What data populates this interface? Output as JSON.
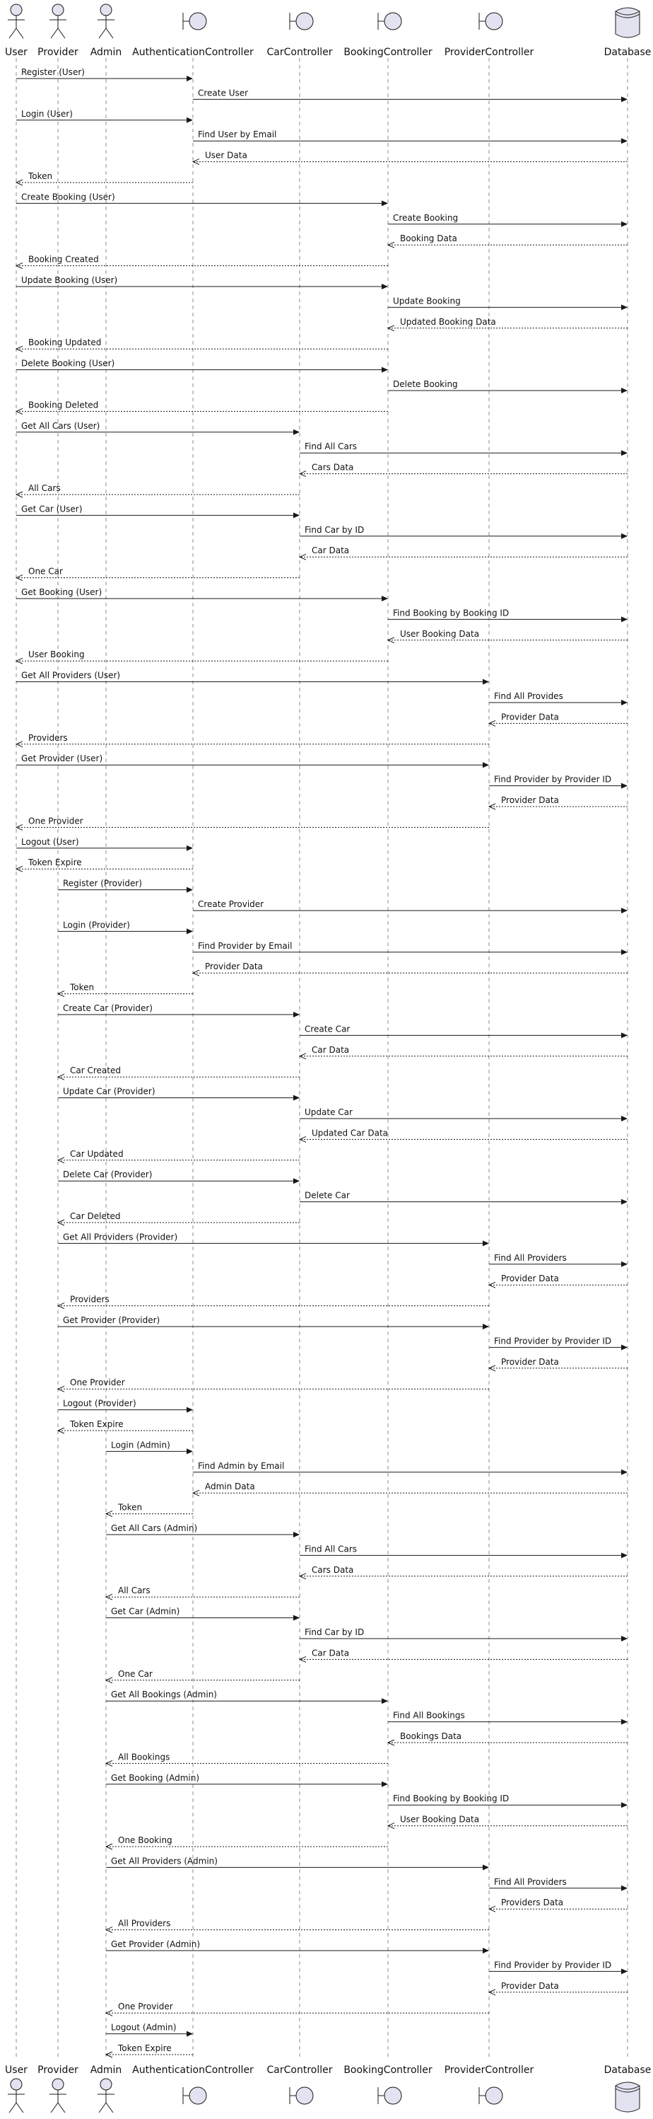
{
  "colors": {
    "shape_fill": "#e2e2f0",
    "line": "#181818",
    "lifeline": "#8a8a8a"
  },
  "participants": [
    {
      "id": "user",
      "name": "User",
      "shape": "actor"
    },
    {
      "id": "provider",
      "name": "Provider",
      "shape": "actor"
    },
    {
      "id": "admin",
      "name": "Admin",
      "shape": "actor"
    },
    {
      "id": "auth",
      "name": "AuthenticationController",
      "shape": "boundary"
    },
    {
      "id": "car",
      "name": "CarController",
      "shape": "boundary"
    },
    {
      "id": "booking",
      "name": "BookingController",
      "shape": "boundary"
    },
    {
      "id": "provctrl",
      "name": "ProviderController",
      "shape": "boundary"
    },
    {
      "id": "db",
      "name": "Database",
      "shape": "database"
    }
  ],
  "messages": [
    {
      "from": "user",
      "to": "auth",
      "label": "Register (User)",
      "style": "solid"
    },
    {
      "from": "auth",
      "to": "db",
      "label": "Create User",
      "style": "solid"
    },
    {
      "from": "user",
      "to": "auth",
      "label": "Login (User)",
      "style": "solid"
    },
    {
      "from": "auth",
      "to": "db",
      "label": "Find User by Email",
      "style": "solid"
    },
    {
      "from": "db",
      "to": "auth",
      "label": "User Data",
      "style": "dashed"
    },
    {
      "from": "auth",
      "to": "user",
      "label": "Token",
      "style": "dashed"
    },
    {
      "from": "user",
      "to": "booking",
      "label": "Create Booking (User)",
      "style": "solid"
    },
    {
      "from": "booking",
      "to": "db",
      "label": "Create Booking",
      "style": "solid"
    },
    {
      "from": "db",
      "to": "booking",
      "label": "Booking Data",
      "style": "dashed"
    },
    {
      "from": "booking",
      "to": "user",
      "label": "Booking Created",
      "style": "dashed"
    },
    {
      "from": "user",
      "to": "booking",
      "label": "Update Booking (User)",
      "style": "solid"
    },
    {
      "from": "booking",
      "to": "db",
      "label": "Update Booking",
      "style": "solid"
    },
    {
      "from": "db",
      "to": "booking",
      "label": "Updated Booking Data",
      "style": "dashed"
    },
    {
      "from": "booking",
      "to": "user",
      "label": "Booking Updated",
      "style": "dashed"
    },
    {
      "from": "user",
      "to": "booking",
      "label": "Delete Booking (User)",
      "style": "solid"
    },
    {
      "from": "booking",
      "to": "db",
      "label": "Delete Booking",
      "style": "solid"
    },
    {
      "from": "booking",
      "to": "user",
      "label": "Booking Deleted",
      "style": "dashed"
    },
    {
      "from": "user",
      "to": "car",
      "label": "Get All Cars (User)",
      "style": "solid"
    },
    {
      "from": "car",
      "to": "db",
      "label": "Find All Cars",
      "style": "solid"
    },
    {
      "from": "db",
      "to": "car",
      "label": "Cars Data",
      "style": "dashed"
    },
    {
      "from": "car",
      "to": "user",
      "label": "All Cars",
      "style": "dashed"
    },
    {
      "from": "user",
      "to": "car",
      "label": "Get Car (User)",
      "style": "solid"
    },
    {
      "from": "car",
      "to": "db",
      "label": "Find Car by ID",
      "style": "solid"
    },
    {
      "from": "db",
      "to": "car",
      "label": "Car Data",
      "style": "dashed"
    },
    {
      "from": "car",
      "to": "user",
      "label": "One Car",
      "style": "dashed"
    },
    {
      "from": "user",
      "to": "booking",
      "label": "Get Booking (User)",
      "style": "solid"
    },
    {
      "from": "booking",
      "to": "db",
      "label": "Find Booking by Booking ID",
      "style": "solid"
    },
    {
      "from": "db",
      "to": "booking",
      "label": "User Booking Data",
      "style": "dashed"
    },
    {
      "from": "booking",
      "to": "user",
      "label": "User Booking",
      "style": "dashed"
    },
    {
      "from": "user",
      "to": "provctrl",
      "label": "Get All Providers (User)",
      "style": "solid"
    },
    {
      "from": "provctrl",
      "to": "db",
      "label": "Find All Provides",
      "style": "solid"
    },
    {
      "from": "db",
      "to": "provctrl",
      "label": "Provider Data",
      "style": "dashed"
    },
    {
      "from": "provctrl",
      "to": "user",
      "label": "Providers",
      "style": "dashed"
    },
    {
      "from": "user",
      "to": "provctrl",
      "label": "Get Provider (User)",
      "style": "solid"
    },
    {
      "from": "provctrl",
      "to": "db",
      "label": "Find Provider by Provider ID",
      "style": "solid"
    },
    {
      "from": "db",
      "to": "provctrl",
      "label": "Provider Data",
      "style": "dashed"
    },
    {
      "from": "provctrl",
      "to": "user",
      "label": "One Provider",
      "style": "dashed"
    },
    {
      "from": "user",
      "to": "auth",
      "label": "Logout (User)",
      "style": "solid"
    },
    {
      "from": "auth",
      "to": "user",
      "label": "Token Expire",
      "style": "dashed"
    },
    {
      "from": "provider",
      "to": "auth",
      "label": "Register (Provider)",
      "style": "solid"
    },
    {
      "from": "auth",
      "to": "db",
      "label": "Create Provider",
      "style": "solid"
    },
    {
      "from": "provider",
      "to": "auth",
      "label": "Login (Provider)",
      "style": "solid"
    },
    {
      "from": "auth",
      "to": "db",
      "label": "Find Provider by Email",
      "style": "solid"
    },
    {
      "from": "db",
      "to": "auth",
      "label": "Provider Data",
      "style": "dashed"
    },
    {
      "from": "auth",
      "to": "provider",
      "label": "Token",
      "style": "dashed"
    },
    {
      "from": "provider",
      "to": "car",
      "label": "Create Car (Provider)",
      "style": "solid"
    },
    {
      "from": "car",
      "to": "db",
      "label": "Create Car",
      "style": "solid"
    },
    {
      "from": "db",
      "to": "car",
      "label": "Car Data",
      "style": "dashed"
    },
    {
      "from": "car",
      "to": "provider",
      "label": "Car Created",
      "style": "dashed"
    },
    {
      "from": "provider",
      "to": "car",
      "label": "Update Car (Provider)",
      "style": "solid"
    },
    {
      "from": "car",
      "to": "db",
      "label": "Update Car",
      "style": "solid"
    },
    {
      "from": "db",
      "to": "car",
      "label": "Updated Car Data",
      "style": "dashed"
    },
    {
      "from": "car",
      "to": "provider",
      "label": "Car Updated",
      "style": "dashed"
    },
    {
      "from": "provider",
      "to": "car",
      "label": "Delete Car (Provider)",
      "style": "solid"
    },
    {
      "from": "car",
      "to": "db",
      "label": "Delete Car",
      "style": "solid"
    },
    {
      "from": "car",
      "to": "provider",
      "label": "Car Deleted",
      "style": "dashed"
    },
    {
      "from": "provider",
      "to": "provctrl",
      "label": "Get All Providers (Provider)",
      "style": "solid"
    },
    {
      "from": "provctrl",
      "to": "db",
      "label": "Find All Providers",
      "style": "solid"
    },
    {
      "from": "db",
      "to": "provctrl",
      "label": "Provider Data",
      "style": "dashed"
    },
    {
      "from": "provctrl",
      "to": "provider",
      "label": "Providers",
      "style": "dashed"
    },
    {
      "from": "provider",
      "to": "provctrl",
      "label": "Get Provider (Provider)",
      "style": "solid"
    },
    {
      "from": "provctrl",
      "to": "db",
      "label": "Find Provider by Provider ID",
      "style": "solid"
    },
    {
      "from": "db",
      "to": "provctrl",
      "label": "Provider Data",
      "style": "dashed"
    },
    {
      "from": "provctrl",
      "to": "provider",
      "label": "One Provider",
      "style": "dashed"
    },
    {
      "from": "provider",
      "to": "auth",
      "label": "Logout (Provider)",
      "style": "solid"
    },
    {
      "from": "auth",
      "to": "provider",
      "label": "Token Expire",
      "style": "dashed"
    },
    {
      "from": "admin",
      "to": "auth",
      "label": "Login (Admin)",
      "style": "solid"
    },
    {
      "from": "auth",
      "to": "db",
      "label": "Find Admin by Email",
      "style": "solid"
    },
    {
      "from": "db",
      "to": "auth",
      "label": "Admin Data",
      "style": "dashed"
    },
    {
      "from": "auth",
      "to": "admin",
      "label": "Token",
      "style": "dashed"
    },
    {
      "from": "admin",
      "to": "car",
      "label": "Get All Cars (Admin)",
      "style": "solid"
    },
    {
      "from": "car",
      "to": "db",
      "label": "Find All Cars",
      "style": "solid"
    },
    {
      "from": "db",
      "to": "car",
      "label": "Cars Data",
      "style": "dashed"
    },
    {
      "from": "car",
      "to": "admin",
      "label": "All Cars",
      "style": "dashed"
    },
    {
      "from": "admin",
      "to": "car",
      "label": "Get Car (Admin)",
      "style": "solid"
    },
    {
      "from": "car",
      "to": "db",
      "label": "Find Car by ID",
      "style": "solid"
    },
    {
      "from": "db",
      "to": "car",
      "label": "Car Data",
      "style": "dashed"
    },
    {
      "from": "car",
      "to": "admin",
      "label": "One Car",
      "style": "dashed"
    },
    {
      "from": "admin",
      "to": "booking",
      "label": "Get All Bookings (Admin)",
      "style": "solid"
    },
    {
      "from": "booking",
      "to": "db",
      "label": "Find All Bookings",
      "style": "solid"
    },
    {
      "from": "db",
      "to": "booking",
      "label": "Bookings Data",
      "style": "dashed"
    },
    {
      "from": "booking",
      "to": "admin",
      "label": "All Bookings",
      "style": "dashed"
    },
    {
      "from": "admin",
      "to": "booking",
      "label": "Get Booking (Admin)",
      "style": "solid"
    },
    {
      "from": "booking",
      "to": "db",
      "label": "Find Booking by Booking ID",
      "style": "solid"
    },
    {
      "from": "db",
      "to": "booking",
      "label": "User Booking Data",
      "style": "dashed"
    },
    {
      "from": "booking",
      "to": "admin",
      "label": "One Booking",
      "style": "dashed"
    },
    {
      "from": "admin",
      "to": "provctrl",
      "label": "Get All Providers (Admin)",
      "style": "solid"
    },
    {
      "from": "provctrl",
      "to": "db",
      "label": "Find All Providers",
      "style": "solid"
    },
    {
      "from": "db",
      "to": "provctrl",
      "label": "Providers Data",
      "style": "dashed"
    },
    {
      "from": "provctrl",
      "to": "admin",
      "label": "All Providers",
      "style": "dashed"
    },
    {
      "from": "admin",
      "to": "provctrl",
      "label": "Get Provider (Admin)",
      "style": "solid"
    },
    {
      "from": "provctrl",
      "to": "db",
      "label": "Find Provider by Provider ID",
      "style": "solid"
    },
    {
      "from": "db",
      "to": "provctrl",
      "label": "Provider Data",
      "style": "dashed"
    },
    {
      "from": "provctrl",
      "to": "admin",
      "label": "One Provider",
      "style": "dashed"
    },
    {
      "from": "admin",
      "to": "auth",
      "label": "Logout (Admin)",
      "style": "solid"
    },
    {
      "from": "auth",
      "to": "admin",
      "label": "Token Expire",
      "style": "dashed"
    }
  ]
}
